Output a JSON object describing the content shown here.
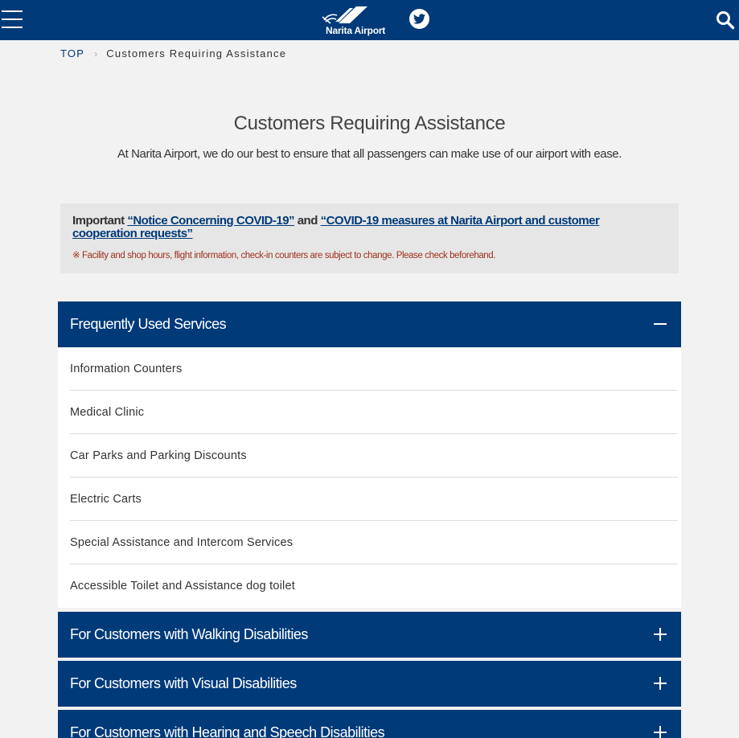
{
  "header": {
    "menu_icon": "hamburger-menu-icon",
    "logo_text": "Narita Airport",
    "twitter_icon": "twitter-icon",
    "search_icon": "search-icon",
    "color": "#003a79"
  },
  "breadcrumb": {
    "top": "TOP",
    "separator": "›",
    "current": "Customers Requiring Assistance"
  },
  "page": {
    "title": "Customers Requiring Assistance",
    "subtitle": "At Narita Airport, we do our best to ensure that all passengers can make use of our airport with ease."
  },
  "notice": {
    "prefix": "Important ",
    "link1": "“Notice Concerning COVID-19”",
    "middle": " and ",
    "link2": "“COVID-19 measures at Narita Airport and customer cooperation requests”",
    "note": "※ Facility and shop hours, flight information, check-in counters are subject to change. Please check beforehand."
  },
  "accordion": {
    "sections": [
      {
        "title": "Frequently Used Services",
        "expanded": true,
        "items": [
          "Information Counters",
          "Medical Clinic",
          "Car Parks and Parking Discounts",
          "Electric Carts",
          "Special Assistance and Intercom Services",
          "Accessible Toilet and Assistance dog toilet"
        ]
      },
      {
        "title": "For Customers with Walking Disabilities",
        "expanded": false
      },
      {
        "title": "For Customers with Visual Disabilities",
        "expanded": false
      },
      {
        "title": "For Customers with Hearing and Speech Disabilities",
        "expanded": false
      }
    ]
  }
}
